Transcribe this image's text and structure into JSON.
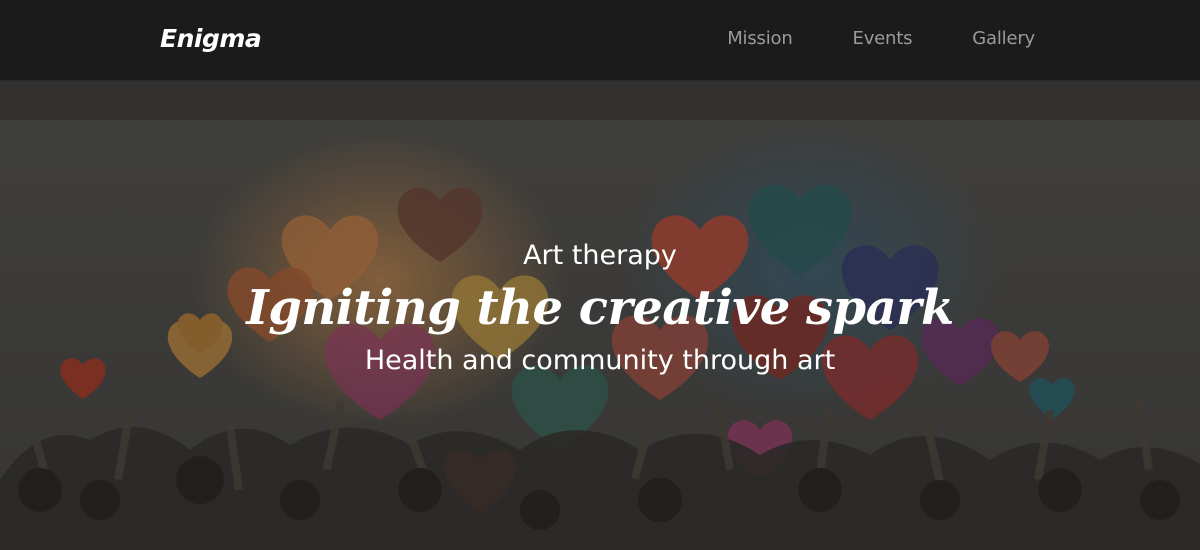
{
  "nav": {
    "brand": "Enigma",
    "links": [
      "Mission",
      "Events",
      "Gallery"
    ]
  },
  "hero": {
    "eyebrow": "Art therapy",
    "title": "Igniting the creative spark",
    "subtitle": "Health and community through art",
    "image": "watercolor illustration of a crowd raising hands with colorful hearts"
  },
  "colors": {
    "navbar": "#1b1b1b",
    "link": "#9a9a9a",
    "text": "#ffffff"
  }
}
